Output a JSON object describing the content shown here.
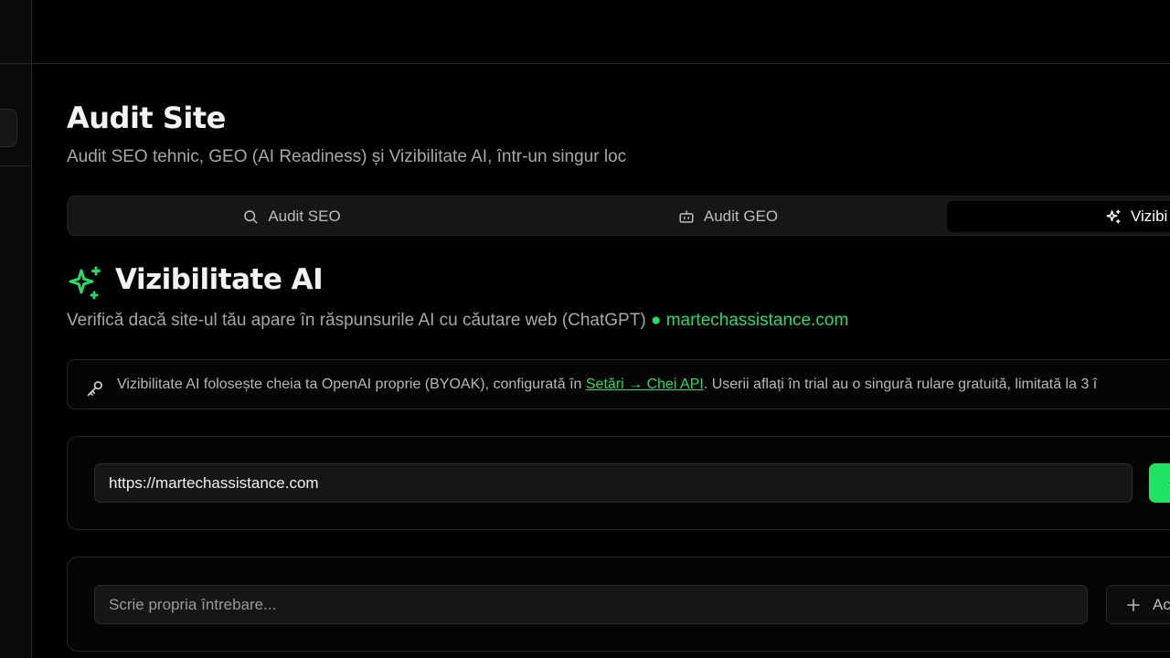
{
  "header": {
    "title": "Audit Site",
    "subtitle": "Audit SEO tehnic, GEO (AI Readiness) și Vizibilitate AI, într-un singur loc"
  },
  "tabs": [
    {
      "label": "Audit SEO",
      "icon": "search-icon",
      "active": false
    },
    {
      "label": "Audit GEO",
      "icon": "robot-icon",
      "active": false
    },
    {
      "label": "Vizibi",
      "icon": "sparkles-icon",
      "active": true
    }
  ],
  "section": {
    "icon": "sparkles-icon",
    "title": "Vizibilitate AI",
    "description": "Verifică dacă site-ul tău apare în răspunsurile AI cu căutare web (ChatGPT)",
    "domain": "● martechassistance.com"
  },
  "notice": {
    "icon": "key-icon",
    "text_before": "Vizibilitate AI folosește cheia ta OpenAI proprie (BYOAK), configurată în ",
    "link": "Setări → Chei API",
    "text_after": ". Userii aflați în trial au o singură rulare gratuită, limitată la 3 î"
  },
  "url_form": {
    "value": "https://martechassistance.com",
    "button_label": "✦"
  },
  "question_form": {
    "placeholder": "Scrie propria întrebare...",
    "add_label": "Ac"
  },
  "colors": {
    "accent": "#22dd66",
    "background": "#000000",
    "surface": "#161616",
    "border": "#262626"
  }
}
